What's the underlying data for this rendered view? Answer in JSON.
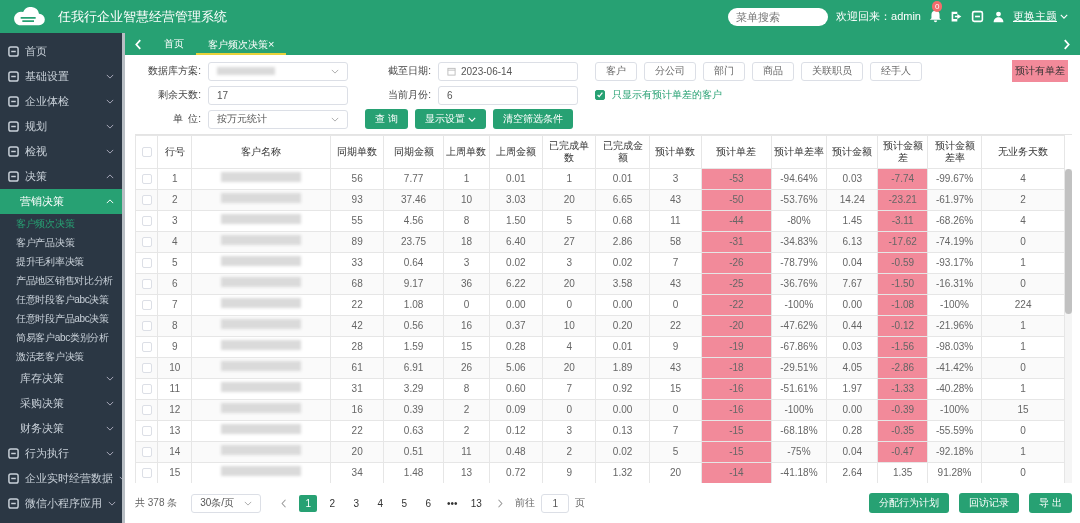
{
  "header": {
    "title": "任我行企业智慧经营管理系统",
    "search": {
      "placeholder": "菜单搜索"
    },
    "welcome": "欢迎回来：admin",
    "notifications": "0",
    "theme": "更换主题"
  },
  "sidebar": {
    "items": [
      {
        "label": "首页"
      },
      {
        "label": "基础设置",
        "expanded": false
      },
      {
        "label": "企业体检",
        "expanded": false
      },
      {
        "label": "规划",
        "expanded": false
      },
      {
        "label": "检视",
        "expanded": false
      },
      {
        "label": "决策",
        "expanded": true,
        "children": [
          {
            "label": "营销决策",
            "expanded": true,
            "selected": true,
            "children": [
              {
                "label": "客户频次决策",
                "selected": true
              },
              {
                "label": "客户产品决策",
                "selected": false
              },
              {
                "label": "提升毛利率决策",
                "selected": false
              },
              {
                "label": "产品地区销售对比分析",
                "selected": false
              },
              {
                "label": "任意时段客户abc决策",
                "selected": false
              },
              {
                "label": "任意时段产品abc决策",
                "selected": false
              },
              {
                "label": "简易客户abc类别分析",
                "selected": false
              },
              {
                "label": "激活老客户决策",
                "selected": false
              }
            ]
          },
          {
            "label": "库存决策",
            "expanded": false,
            "selected": false
          },
          {
            "label": "采购决策",
            "expanded": false,
            "selected": false
          },
          {
            "label": "财务决策",
            "expanded": false,
            "selected": false
          }
        ]
      },
      {
        "label": "行为执行",
        "expanded": false
      },
      {
        "label": "企业实时经营数据",
        "expanded": false
      },
      {
        "label": "微信小程序应用",
        "expanded": false
      }
    ]
  },
  "tabs": [
    {
      "label": "首页",
      "selected": false
    },
    {
      "label": "客户频次决策",
      "selected": true,
      "close": "×"
    }
  ],
  "filters": {
    "scheme_label": "数据库方案:",
    "date_label": "截至日期:",
    "date": "2023-06-14",
    "dimension_buttons": [
      "客户",
      "分公司",
      "部门",
      "商品",
      "关联职员",
      "经手人"
    ],
    "badge": "预计有单差",
    "days_label": "剩余天数:",
    "days": "17",
    "month_label": "当前月份:",
    "month": "6",
    "only_diff": {
      "label": "只显示有预计单差的客户",
      "checked": true
    },
    "unit_label": "单  位:",
    "unit": "按万元统计",
    "query": "查 询",
    "display": "显示设置",
    "clear": "清空筛选条件"
  },
  "table": {
    "select_all_checked": false,
    "columns": [
      "行号",
      "客户名称",
      "同期单数",
      "同期金额",
      "上周单数",
      "上周金额",
      "已完成单数",
      "已完成金额",
      "预计单数",
      "预计单差",
      "预计单差率",
      "预计金额",
      "预计金额差",
      "预计金额差率",
      "无业务天数"
    ],
    "rows": [
      {
        "checked": false,
        "diff_alert": true,
        "amount_alert": true,
        "cells": [
          "1",
          "",
          "56",
          "7.77",
          "1",
          "0.01",
          "1",
          "0.01",
          "3",
          "-53",
          "-94.64%",
          "0.03",
          "-7.74",
          "-99.67%",
          "4"
        ]
      },
      {
        "checked": false,
        "diff_alert": true,
        "amount_alert": true,
        "cells": [
          "2",
          "",
          "93",
          "37.46",
          "10",
          "3.03",
          "20",
          "6.65",
          "43",
          "-50",
          "-53.76%",
          "14.24",
          "-23.21",
          "-61.97%",
          "2"
        ]
      },
      {
        "checked": false,
        "diff_alert": true,
        "amount_alert": true,
        "cells": [
          "3",
          "",
          "55",
          "4.56",
          "8",
          "1.50",
          "5",
          "0.68",
          "11",
          "-44",
          "-80%",
          "1.45",
          "-3.11",
          "-68.26%",
          "4"
        ]
      },
      {
        "checked": false,
        "diff_alert": true,
        "amount_alert": true,
        "cells": [
          "4",
          "",
          "89",
          "23.75",
          "18",
          "6.40",
          "27",
          "2.86",
          "58",
          "-31",
          "-34.83%",
          "6.13",
          "-17.62",
          "-74.19%",
          "0"
        ]
      },
      {
        "checked": false,
        "diff_alert": true,
        "amount_alert": true,
        "cells": [
          "5",
          "",
          "33",
          "0.64",
          "3",
          "0.02",
          "3",
          "0.02",
          "7",
          "-26",
          "-78.79%",
          "0.04",
          "-0.59",
          "-93.17%",
          "1"
        ]
      },
      {
        "checked": false,
        "diff_alert": true,
        "amount_alert": true,
        "cells": [
          "6",
          "",
          "68",
          "9.17",
          "36",
          "6.22",
          "20",
          "3.58",
          "43",
          "-25",
          "-36.76%",
          "7.67",
          "-1.50",
          "-16.31%",
          "0"
        ]
      },
      {
        "checked": false,
        "diff_alert": true,
        "amount_alert": true,
        "cells": [
          "7",
          "",
          "22",
          "1.08",
          "0",
          "0.00",
          "0",
          "0.00",
          "0",
          "-22",
          "-100%",
          "0.00",
          "-1.08",
          "-100%",
          "224"
        ]
      },
      {
        "checked": false,
        "diff_alert": true,
        "amount_alert": true,
        "cells": [
          "8",
          "",
          "42",
          "0.56",
          "16",
          "0.37",
          "10",
          "0.20",
          "22",
          "-20",
          "-47.62%",
          "0.44",
          "-0.12",
          "-21.96%",
          "1"
        ]
      },
      {
        "checked": false,
        "diff_alert": true,
        "amount_alert": true,
        "cells": [
          "9",
          "",
          "28",
          "1.59",
          "15",
          "0.28",
          "4",
          "0.01",
          "9",
          "-19",
          "-67.86%",
          "0.03",
          "-1.56",
          "-98.03%",
          "1"
        ]
      },
      {
        "checked": false,
        "diff_alert": true,
        "amount_alert": true,
        "cells": [
          "10",
          "",
          "61",
          "6.91",
          "26",
          "5.06",
          "20",
          "1.89",
          "43",
          "-18",
          "-29.51%",
          "4.05",
          "-2.86",
          "-41.42%",
          "0"
        ]
      },
      {
        "checked": false,
        "diff_alert": true,
        "amount_alert": true,
        "cells": [
          "11",
          "",
          "31",
          "3.29",
          "8",
          "0.60",
          "7",
          "0.92",
          "15",
          "-16",
          "-51.61%",
          "1.97",
          "-1.33",
          "-40.28%",
          "1"
        ]
      },
      {
        "checked": false,
        "diff_alert": true,
        "amount_alert": true,
        "cells": [
          "12",
          "",
          "16",
          "0.39",
          "2",
          "0.09",
          "0",
          "0.00",
          "0",
          "-16",
          "-100%",
          "0.00",
          "-0.39",
          "-100%",
          "15"
        ]
      },
      {
        "checked": false,
        "diff_alert": true,
        "amount_alert": true,
        "cells": [
          "13",
          "",
          "22",
          "0.63",
          "2",
          "0.12",
          "3",
          "0.13",
          "7",
          "-15",
          "-68.18%",
          "0.28",
          "-0.35",
          "-55.59%",
          "0"
        ]
      },
      {
        "checked": false,
        "diff_alert": true,
        "amount_alert": true,
        "cells": [
          "14",
          "",
          "20",
          "0.51",
          "11",
          "0.48",
          "2",
          "0.02",
          "5",
          "-15",
          "-75%",
          "0.04",
          "-0.47",
          "-92.18%",
          "1"
        ]
      },
      {
        "checked": false,
        "diff_alert": true,
        "amount_alert": false,
        "cells": [
          "15",
          "",
          "34",
          "1.48",
          "13",
          "0.72",
          "9",
          "1.32",
          "20",
          "-14",
          "-41.18%",
          "2.64",
          "1.35",
          "91.28%",
          "0"
        ]
      }
    ]
  },
  "footer": {
    "total": "共 378 条",
    "page_size": "30条/页",
    "pages": [
      {
        "label": "1",
        "selected": true
      },
      {
        "label": "2",
        "selected": false
      },
      {
        "label": "3",
        "selected": false
      },
      {
        "label": "4",
        "selected": false
      },
      {
        "label": "5",
        "selected": false
      },
      {
        "label": "6",
        "selected": false
      },
      {
        "label": "•••",
        "selected": false
      },
      {
        "label": "13",
        "selected": false
      }
    ],
    "goto_label": "前往",
    "goto_value": "1",
    "page_unit": "页",
    "actions": [
      "分配行为计划",
      "回访记录",
      "导 出"
    ]
  }
}
